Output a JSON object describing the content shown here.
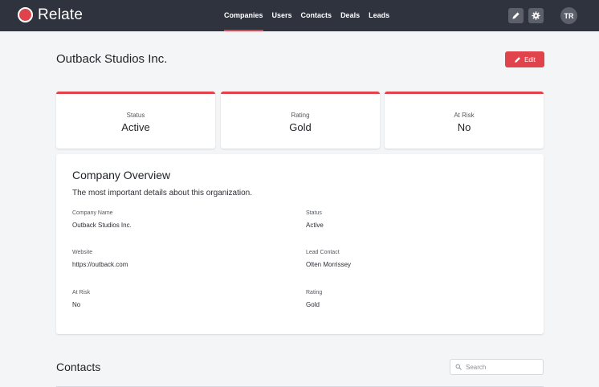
{
  "app": {
    "name": "Relate"
  },
  "nav": {
    "items": [
      {
        "label": "Companies",
        "active": true
      },
      {
        "label": "Users",
        "active": false
      },
      {
        "label": "Contacts",
        "active": false
      },
      {
        "label": "Deals",
        "active": false
      },
      {
        "label": "Leads",
        "active": false
      }
    ]
  },
  "user": {
    "initials": "TR"
  },
  "header": {
    "title": "Outback Studios Inc.",
    "edit_label": "Edit"
  },
  "stats": [
    {
      "label": "Status",
      "value": "Active"
    },
    {
      "label": "Rating",
      "value": "Gold"
    },
    {
      "label": "At Risk",
      "value": "No"
    }
  ],
  "overview": {
    "title": "Company Overview",
    "subtitle": "The most important details about this organization.",
    "fields": [
      {
        "label": "Company Name",
        "value": "Outback Studios Inc."
      },
      {
        "label": "Status",
        "value": "Active"
      },
      {
        "label": "Website",
        "value": "https://outback.com"
      },
      {
        "label": "Lead Contact",
        "value": "Olten Morrissey"
      },
      {
        "label": "At Risk",
        "value": "No"
      },
      {
        "label": "Rating",
        "value": "Gold"
      }
    ]
  },
  "contacts": {
    "title": "Contacts",
    "search_placeholder": "Search"
  },
  "colors": {
    "accent": "#e0434b",
    "topbar": "#2f333d",
    "background": "#f4f5f7"
  }
}
